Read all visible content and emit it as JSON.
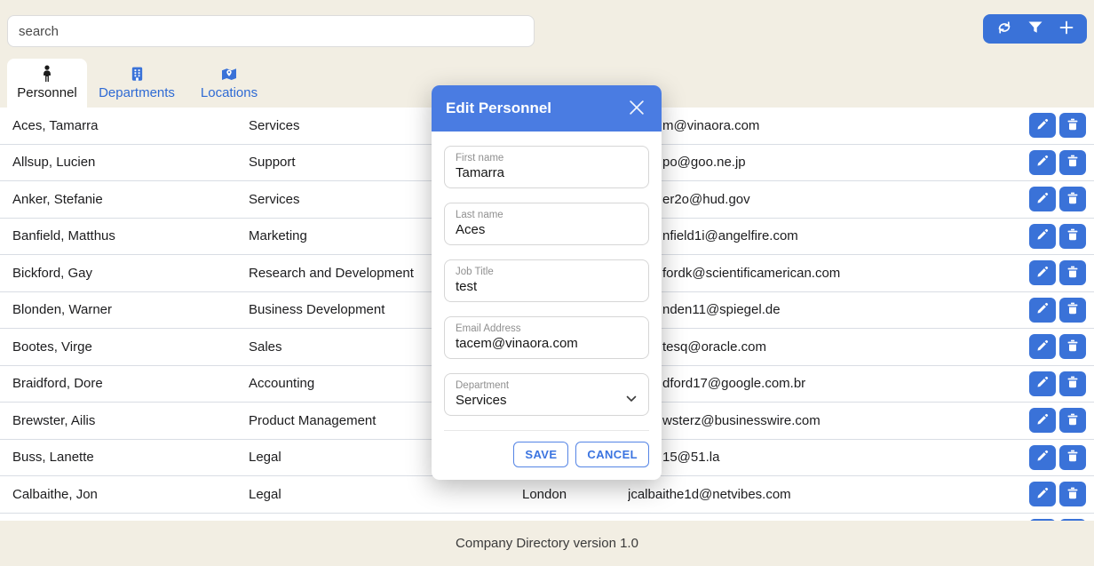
{
  "app": {
    "footer": "Company Directory version 1.0"
  },
  "search": {
    "placeholder": "search"
  },
  "toolbar": {
    "buttons": [
      "refresh-icon",
      "filter-icon",
      "plus-icon"
    ]
  },
  "tabs": [
    {
      "id": "personnel",
      "label": "Personnel",
      "icon": "person-icon",
      "active": true
    },
    {
      "id": "departments",
      "label": "Departments",
      "icon": "building-icon",
      "active": false
    },
    {
      "id": "locations",
      "label": "Locations",
      "icon": "map-icon",
      "active": false
    }
  ],
  "table": {
    "rows": [
      {
        "name": "Aces, Tamarra",
        "department": "Services",
        "location": "",
        "email": "m@vinaora.com"
      },
      {
        "name": "Allsup, Lucien",
        "department": "Support",
        "location": "",
        "email": "po@goo.ne.jp"
      },
      {
        "name": "Anker, Stefanie",
        "department": "Services",
        "location": "",
        "email": "er2o@hud.gov"
      },
      {
        "name": "Banfield, Matthus",
        "department": "Marketing",
        "location": "",
        "email": "nfield1i@angelfire.com"
      },
      {
        "name": "Bickford, Gay",
        "department": "Research and Development",
        "location": "",
        "email": "fordk@scientificamerican.com"
      },
      {
        "name": "Blonden, Warner",
        "department": "Business Development",
        "location": "",
        "email": "nden11@spiegel.de"
      },
      {
        "name": "Bootes, Virge",
        "department": "Sales",
        "location": "",
        "email": "tesq@oracle.com"
      },
      {
        "name": "Braidford, Dore",
        "department": "Accounting",
        "location": "",
        "email": "dford17@google.com.br"
      },
      {
        "name": "Brewster, Ailis",
        "department": "Product Management",
        "location": "",
        "email": "wsterz@businesswire.com"
      },
      {
        "name": "Buss, Lanette",
        "department": "Legal",
        "location": "",
        "email": "15@51.la"
      },
      {
        "name": "Calbaithe, Jon",
        "department": "Legal",
        "location": "London",
        "email": "jcalbaithe1d@netvibes.com"
      },
      {
        "name": "",
        "department": "",
        "location": "",
        "email": ""
      }
    ]
  },
  "modal": {
    "title": "Edit Personnel",
    "fields": [
      {
        "label": "First name",
        "value": "Tamarra",
        "type": "text"
      },
      {
        "label": "Last name",
        "value": "Aces",
        "type": "text"
      },
      {
        "label": "Job Title",
        "value": "test",
        "type": "text"
      },
      {
        "label": "Email Address",
        "value": "tacem@vinaora.com",
        "type": "text"
      },
      {
        "label": "Department",
        "value": "Services",
        "type": "select"
      }
    ],
    "save_label": "SAVE",
    "cancel_label": "CANCEL"
  },
  "colors": {
    "accent": "#3a72d8",
    "modal_header": "#4a7ce2",
    "background": "#f2eee3",
    "row_divider": "#d9dde4"
  }
}
